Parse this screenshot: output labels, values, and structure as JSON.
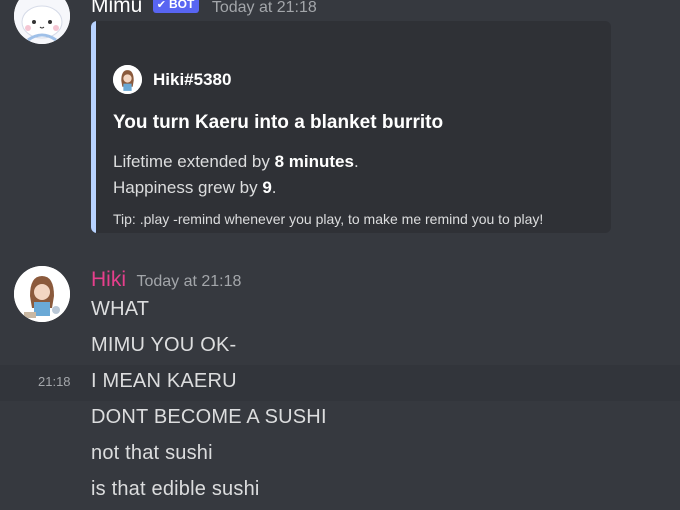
{
  "messages": [
    {
      "author": "Mimu",
      "author_color": "#ffffff",
      "badge": "BOT",
      "badge_icon": "checkmark-icon",
      "timestamp": "Today at 21:18",
      "embed": {
        "accent_color": "#b8d3ff",
        "author_name": "Hiki#5380",
        "title": "You turn Kaeru into a blanket burrito",
        "description": {
          "line1_prefix": "Lifetime extended by ",
          "line1_bold": "8 minutes",
          "line1_suffix": ".",
          "line2_prefix": "Happiness grew by ",
          "line2_bold": "9",
          "line2_suffix": "."
        },
        "footer": "Tip: .play -remind whenever you play, to make me remind you to play!"
      }
    },
    {
      "author": "Hiki",
      "author_color": "#e63f8c",
      "timestamp": "Today at 21:18",
      "lines": [
        "WHAT",
        "MIMU YOU OK-",
        "I MEAN KAERU",
        "DONT BECOME A SUSHI",
        "not that sushi",
        "is that edible sushi"
      ],
      "hover_timestamp": "21:18"
    }
  ]
}
